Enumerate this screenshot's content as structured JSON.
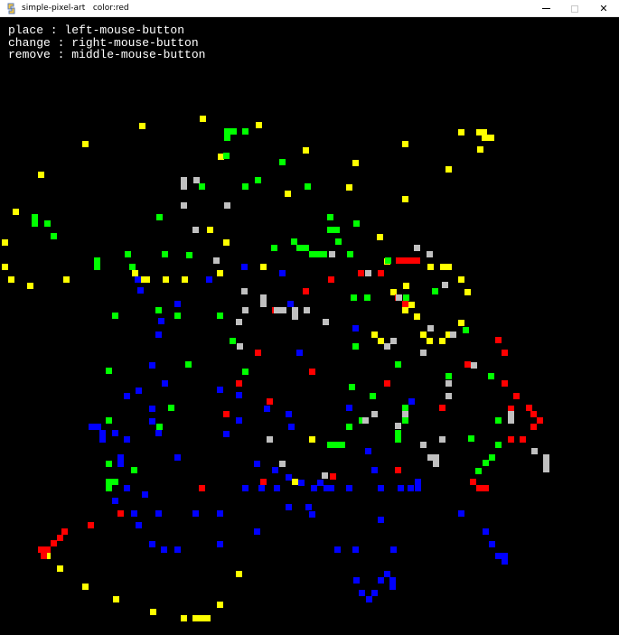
{
  "window": {
    "title": "simple-pixel-art   color:red",
    "minimize_label": "—",
    "maximize_label": "☐",
    "close_label": "✕"
  },
  "help": {
    "lines": [
      "place : left-mouse-button",
      "change : right-mouse-button",
      "remove : middle-mouse-button"
    ]
  },
  "colors": {
    "yellow": "#ffff00",
    "green": "#00ff00",
    "blue": "#0000ff",
    "red": "#ff0000",
    "gray": "#c0c0c0",
    "background": "#000000"
  }
}
